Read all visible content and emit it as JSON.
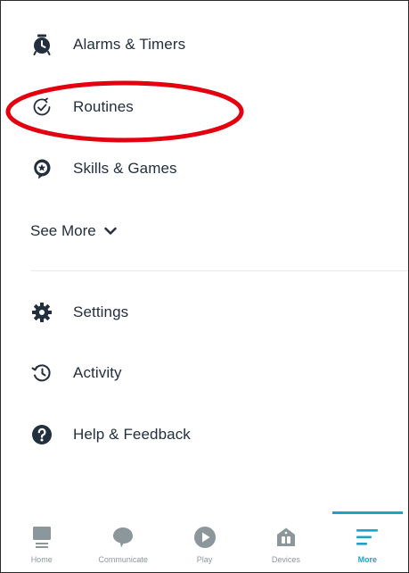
{
  "menu": {
    "primary": [
      {
        "label": "Alarms & Timers",
        "icon": "alarm-clock-icon"
      },
      {
        "label": "Routines",
        "icon": "routines-check-icon"
      },
      {
        "label": "Skills & Games",
        "icon": "skills-star-icon"
      }
    ],
    "see_more_label": "See More",
    "secondary": [
      {
        "label": "Settings",
        "icon": "gear-icon"
      },
      {
        "label": "Activity",
        "icon": "history-icon"
      },
      {
        "label": "Help & Feedback",
        "icon": "help-icon"
      }
    ]
  },
  "annotation": {
    "color": "#e3000f",
    "target": "Routines"
  },
  "bottom_nav": {
    "tabs": [
      {
        "label": "Home",
        "icon": "home-icon"
      },
      {
        "label": "Communicate",
        "icon": "chat-bubble-icon"
      },
      {
        "label": "Play",
        "icon": "play-icon"
      },
      {
        "label": "Devices",
        "icon": "devices-house-icon"
      },
      {
        "label": "More",
        "icon": "hamburger-menu-icon"
      }
    ],
    "active_tab": "More"
  },
  "colors": {
    "text": "#232f3e",
    "icon_dark": "#232f3e",
    "nav_inactive": "#8c979c",
    "nav_active": "#1fa3c4",
    "divider": "#e8ebec"
  }
}
